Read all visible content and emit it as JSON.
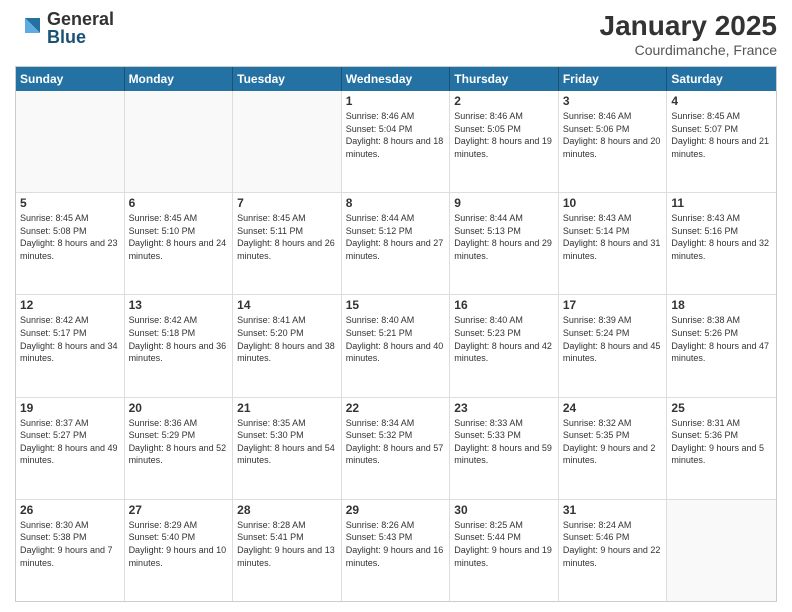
{
  "logo": {
    "general": "General",
    "blue": "Blue"
  },
  "title": "January 2025",
  "location": "Courdimanche, France",
  "days": [
    "Sunday",
    "Monday",
    "Tuesday",
    "Wednesday",
    "Thursday",
    "Friday",
    "Saturday"
  ],
  "rows": [
    [
      {
        "day": "",
        "content": ""
      },
      {
        "day": "",
        "content": ""
      },
      {
        "day": "",
        "content": ""
      },
      {
        "day": "1",
        "content": "Sunrise: 8:46 AM\nSunset: 5:04 PM\nDaylight: 8 hours and 18 minutes."
      },
      {
        "day": "2",
        "content": "Sunrise: 8:46 AM\nSunset: 5:05 PM\nDaylight: 8 hours and 19 minutes."
      },
      {
        "day": "3",
        "content": "Sunrise: 8:46 AM\nSunset: 5:06 PM\nDaylight: 8 hours and 20 minutes."
      },
      {
        "day": "4",
        "content": "Sunrise: 8:45 AM\nSunset: 5:07 PM\nDaylight: 8 hours and 21 minutes."
      }
    ],
    [
      {
        "day": "5",
        "content": "Sunrise: 8:45 AM\nSunset: 5:08 PM\nDaylight: 8 hours and 23 minutes."
      },
      {
        "day": "6",
        "content": "Sunrise: 8:45 AM\nSunset: 5:10 PM\nDaylight: 8 hours and 24 minutes."
      },
      {
        "day": "7",
        "content": "Sunrise: 8:45 AM\nSunset: 5:11 PM\nDaylight: 8 hours and 26 minutes."
      },
      {
        "day": "8",
        "content": "Sunrise: 8:44 AM\nSunset: 5:12 PM\nDaylight: 8 hours and 27 minutes."
      },
      {
        "day": "9",
        "content": "Sunrise: 8:44 AM\nSunset: 5:13 PM\nDaylight: 8 hours and 29 minutes."
      },
      {
        "day": "10",
        "content": "Sunrise: 8:43 AM\nSunset: 5:14 PM\nDaylight: 8 hours and 31 minutes."
      },
      {
        "day": "11",
        "content": "Sunrise: 8:43 AM\nSunset: 5:16 PM\nDaylight: 8 hours and 32 minutes."
      }
    ],
    [
      {
        "day": "12",
        "content": "Sunrise: 8:42 AM\nSunset: 5:17 PM\nDaylight: 8 hours and 34 minutes."
      },
      {
        "day": "13",
        "content": "Sunrise: 8:42 AM\nSunset: 5:18 PM\nDaylight: 8 hours and 36 minutes."
      },
      {
        "day": "14",
        "content": "Sunrise: 8:41 AM\nSunset: 5:20 PM\nDaylight: 8 hours and 38 minutes."
      },
      {
        "day": "15",
        "content": "Sunrise: 8:40 AM\nSunset: 5:21 PM\nDaylight: 8 hours and 40 minutes."
      },
      {
        "day": "16",
        "content": "Sunrise: 8:40 AM\nSunset: 5:23 PM\nDaylight: 8 hours and 42 minutes."
      },
      {
        "day": "17",
        "content": "Sunrise: 8:39 AM\nSunset: 5:24 PM\nDaylight: 8 hours and 45 minutes."
      },
      {
        "day": "18",
        "content": "Sunrise: 8:38 AM\nSunset: 5:26 PM\nDaylight: 8 hours and 47 minutes."
      }
    ],
    [
      {
        "day": "19",
        "content": "Sunrise: 8:37 AM\nSunset: 5:27 PM\nDaylight: 8 hours and 49 minutes."
      },
      {
        "day": "20",
        "content": "Sunrise: 8:36 AM\nSunset: 5:29 PM\nDaylight: 8 hours and 52 minutes."
      },
      {
        "day": "21",
        "content": "Sunrise: 8:35 AM\nSunset: 5:30 PM\nDaylight: 8 hours and 54 minutes."
      },
      {
        "day": "22",
        "content": "Sunrise: 8:34 AM\nSunset: 5:32 PM\nDaylight: 8 hours and 57 minutes."
      },
      {
        "day": "23",
        "content": "Sunrise: 8:33 AM\nSunset: 5:33 PM\nDaylight: 8 hours and 59 minutes."
      },
      {
        "day": "24",
        "content": "Sunrise: 8:32 AM\nSunset: 5:35 PM\nDaylight: 9 hours and 2 minutes."
      },
      {
        "day": "25",
        "content": "Sunrise: 8:31 AM\nSunset: 5:36 PM\nDaylight: 9 hours and 5 minutes."
      }
    ],
    [
      {
        "day": "26",
        "content": "Sunrise: 8:30 AM\nSunset: 5:38 PM\nDaylight: 9 hours and 7 minutes."
      },
      {
        "day": "27",
        "content": "Sunrise: 8:29 AM\nSunset: 5:40 PM\nDaylight: 9 hours and 10 minutes."
      },
      {
        "day": "28",
        "content": "Sunrise: 8:28 AM\nSunset: 5:41 PM\nDaylight: 9 hours and 13 minutes."
      },
      {
        "day": "29",
        "content": "Sunrise: 8:26 AM\nSunset: 5:43 PM\nDaylight: 9 hours and 16 minutes."
      },
      {
        "day": "30",
        "content": "Sunrise: 8:25 AM\nSunset: 5:44 PM\nDaylight: 9 hours and 19 minutes."
      },
      {
        "day": "31",
        "content": "Sunrise: 8:24 AM\nSunset: 5:46 PM\nDaylight: 9 hours and 22 minutes."
      },
      {
        "day": "",
        "content": ""
      }
    ]
  ]
}
